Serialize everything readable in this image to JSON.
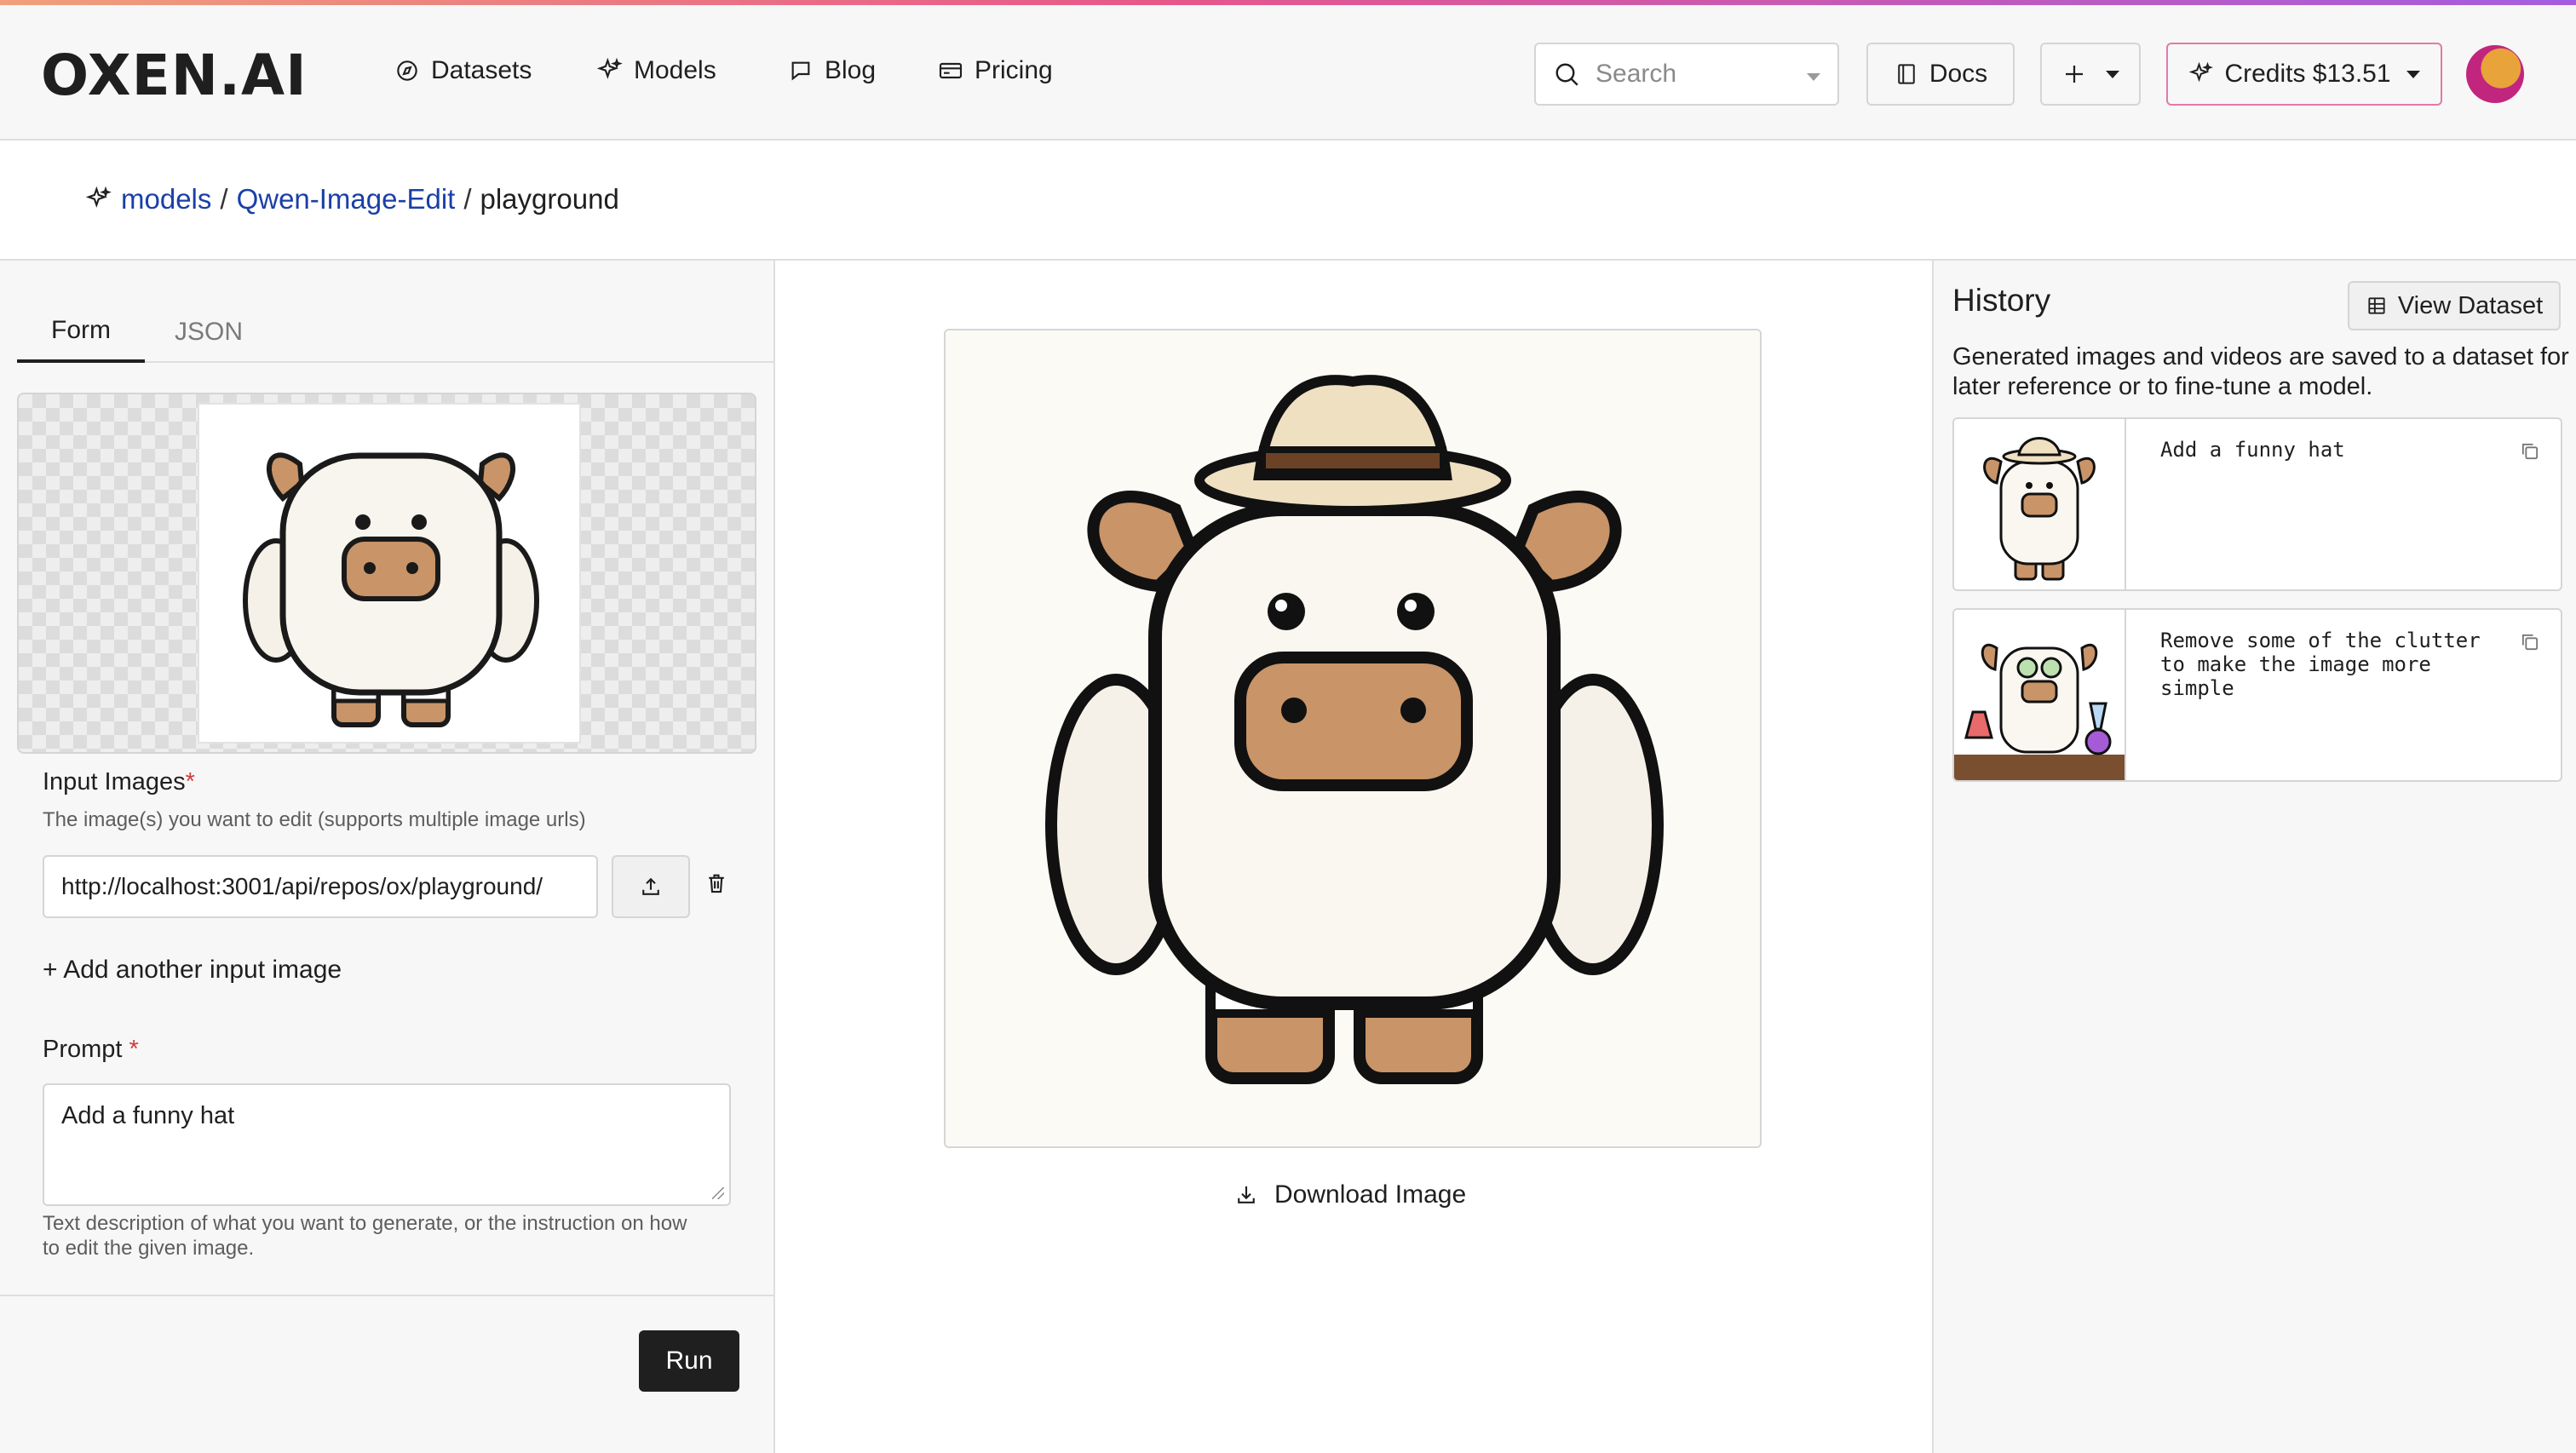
{
  "header": {
    "logo": "OXEN.AI",
    "nav": [
      {
        "label": "Datasets",
        "icon": "compass-icon"
      },
      {
        "label": "Models",
        "icon": "sparkles-icon"
      },
      {
        "label": "Blog",
        "icon": "chat-bubble-icon"
      },
      {
        "label": "Pricing",
        "icon": "credit-card-icon"
      }
    ],
    "search_placeholder": "Search",
    "docs_label": "Docs",
    "credits_label": "Credits $13.51"
  },
  "breadcrumb": {
    "models": "models",
    "sep1": "/",
    "model": "Qwen-Image-Edit",
    "sep2": "/",
    "page": "playground"
  },
  "form": {
    "tabs": [
      "Form",
      "JSON"
    ],
    "input_images_label": "Input Images",
    "required_mark": "*",
    "input_images_help": "The image(s) you want to edit (supports multiple image urls)",
    "image_url": "http://localhost:3001/api/repos/ox/playground/",
    "add_image": "+ Add another input image",
    "prompt_label": "Prompt",
    "prompt_value": "Add a funny hat",
    "prompt_help": "Text description of what you want to generate, or the instruction on how to edit the given image.",
    "run_label": "Run"
  },
  "output": {
    "download_label": "Download Image"
  },
  "history": {
    "title": "History",
    "view_dataset": "View Dataset",
    "description": "Generated images and videos are saved to a dataset for later reference or to fine-tune a model.",
    "items": [
      {
        "prompt": "Add a funny hat"
      },
      {
        "prompt": "Remove some of the clutter to make the image more simple"
      }
    ]
  },
  "colors": {
    "accent_link": "#1a3fa8",
    "required": "#d23b3b",
    "run_button": "#1f1f1f",
    "credits_border": "#e27aa8"
  }
}
